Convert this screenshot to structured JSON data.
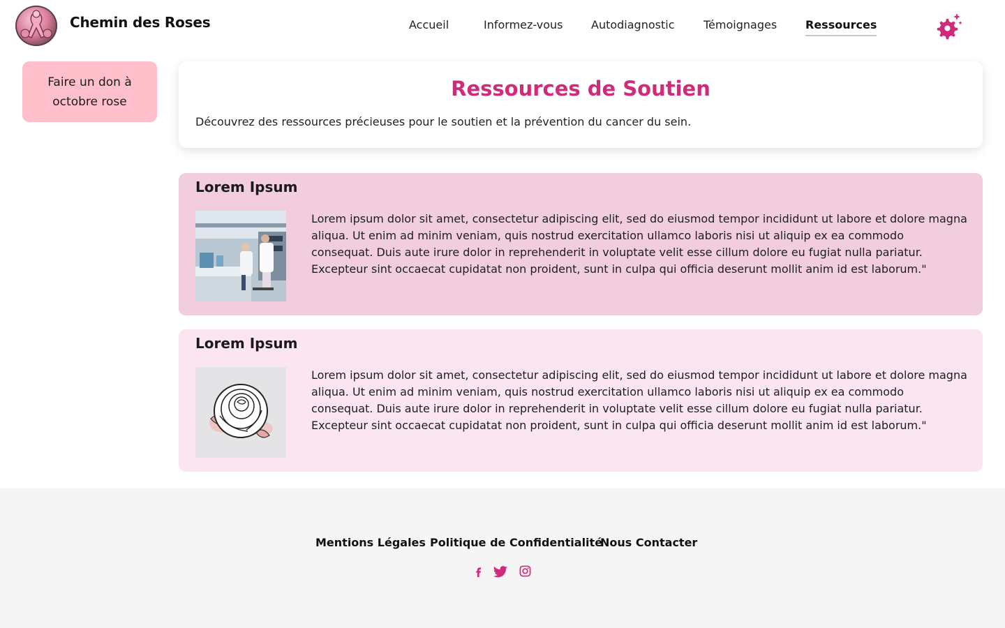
{
  "header": {
    "brand": "Chemin des Roses",
    "nav": [
      {
        "label": "Accueil"
      },
      {
        "label": "Informez-vous"
      },
      {
        "label": "Autodiagnostic"
      },
      {
        "label": "Témoignages"
      },
      {
        "label": "Ressources",
        "active": true
      }
    ]
  },
  "sidebar": {
    "donate_label": "Faire un don à octobre rose"
  },
  "intro": {
    "title": "Ressources de Soutien",
    "text": "Découvrez des ressources précieuses pour le soutien et la prévention du cancer du sein."
  },
  "resources": [
    {
      "title": "Lorem Ipsum",
      "image": "laboratory-photo",
      "text": "Lorem ipsum dolor sit amet, consectetur adipiscing elit, sed do eiusmod tempor incididunt ut labore et dolore magna aliqua. Ut enim ad minim veniam, quis nostrud exercitation ullamco laboris nisi ut aliquip ex ea commodo consequat. Duis aute irure dolor in reprehenderit in voluptate velit esse cillum dolore eu fugiat nulla pariatur. Excepteur sint occaecat cupidatat non proident, sunt in culpa qui officia deserunt mollit anim id est laborum.\""
    },
    {
      "title": "Lorem Ipsum",
      "image": "rose-illustration",
      "text": "Lorem ipsum dolor sit amet, consectetur adipiscing elit, sed do eiusmod tempor incididunt ut labore et dolore magna aliqua. Ut enim ad minim veniam, quis nostrud exercitation ullamco laboris nisi ut aliquip ex ea commodo consequat. Duis aute irure dolor in reprehenderit in voluptate velit esse cillum dolore eu fugiat nulla pariatur. Excepteur sint occaecat cupidatat non proident, sunt in culpa qui officia deserunt mollit anim id est laborum.\""
    }
  ],
  "footer": {
    "links": [
      "Mentions Légales",
      "Politique de Confidentialité",
      "Nous Contacter"
    ],
    "social_icons": [
      "facebook-icon",
      "twitter-icon",
      "instagram-icon"
    ]
  },
  "colors": {
    "accent": "#d02a7b",
    "donate_bg": "#ffbfcb",
    "card_primary_bg": "#f2cddd",
    "card_secondary_bg": "#fbe5f0",
    "footer_bg": "#f5f5f5"
  },
  "icons": {
    "settings": "gear-sparkle-icon",
    "logo": "pink-ribbon-roses-logo"
  }
}
